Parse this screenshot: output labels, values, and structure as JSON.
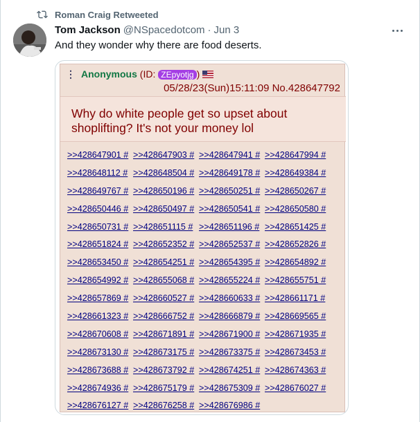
{
  "retweet": {
    "label": "Roman Craig Retweeted"
  },
  "tweet": {
    "display_name": "Tom Jackson",
    "handle": "@NSpacedotcom",
    "separator": "·",
    "date": "Jun 3",
    "text": "And they wonder why there are food deserts."
  },
  "post": {
    "menu": "⋮",
    "name": "Anonymous",
    "id_prefix": "(ID:",
    "id": "ZEpyotjg",
    "id_suffix": ")",
    "flag_icon": "us-flag-icon",
    "datetime": "05/28/23(Sun)15:11:09 No.428647792",
    "body": "Why do white people get so upset about shoplifting? It's not your money lol",
    "replies": [
      ">>428647901 #",
      ">>428647903 #",
      ">>428647941 #",
      ">>428647994 #",
      ">>428648112 #",
      ">>428648504 #",
      ">>428649178 #",
      ">>428649384 #",
      ">>428649767 #",
      ">>428650196 #",
      ">>428650251 #",
      ">>428650267 #",
      ">>428650446 #",
      ">>428650497 #",
      ">>428650541 #",
      ">>428650580 #",
      ">>428650731 #",
      ">>428651115 #",
      ">>428651196 #",
      ">>428651425 #",
      ">>428651824 #",
      ">>428652352 #",
      ">>428652537 #",
      ">>428652826 #",
      ">>428653450 #",
      ">>428654251 #",
      ">>428654395 #",
      ">>428654892 #",
      ">>428654992 #",
      ">>428655068 #",
      ">>428655224 #",
      ">>428655751 #",
      ">>428657869 #",
      ">>428660527 #",
      ">>428660633 #",
      ">>428661171 #",
      ">>428661323 #",
      ">>428666752 #",
      ">>428666879 #",
      ">>428669565 #",
      ">>428670608 #",
      ">>428671891 #",
      ">>428671900 #",
      ">>428671935 #",
      ">>428673130 #",
      ">>428673175 #",
      ">>428673375 #",
      ">>428673453 #",
      ">>428673688 #",
      ">>428673792 #",
      ">>428674251 #",
      ">>428674363 #",
      ">>428674936 #",
      ">>428675179 #",
      ">>428675309 #",
      ">>428676027 #",
      ">>428676127 #",
      ">>428676258 #",
      ">>428676986 #"
    ]
  },
  "colors": {
    "accent_green": "#117743",
    "id_purple": "#a43ee4",
    "post_bg": "#f0e0d6"
  }
}
